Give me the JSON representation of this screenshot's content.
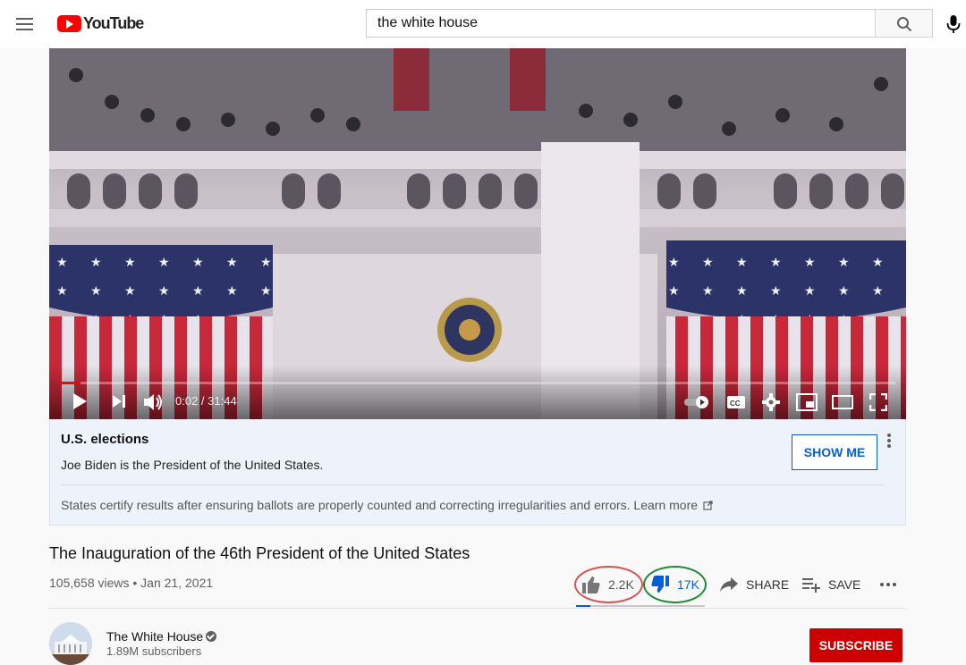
{
  "header": {
    "logo_text": "YouTube",
    "search_value": "the white house",
    "icons": [
      "menu-icon",
      "search-icon",
      "mic-icon"
    ]
  },
  "player": {
    "time": "0:02 / 31:44",
    "progress": 0.0011,
    "controls": [
      "play-icon",
      "next-icon",
      "volume-icon",
      "autoplay-toggle",
      "captions-icon",
      "settings-icon",
      "miniplayer-icon",
      "theater-icon",
      "fullscreen-icon"
    ]
  },
  "info_panel": {
    "title": "U.S. elections",
    "subtitle": "Joe Biden is the President of the United States.",
    "button": "SHOW ME",
    "note": "States certify results after ensuring ballots are properly counted and correcting irregularities and errors.",
    "learn_more": "Learn more"
  },
  "video": {
    "title": "The Inauguration of the 46th President of the United States",
    "meta": "105,658 views • Jan 21, 2021",
    "likes": "2.2K",
    "dislikes": "17K",
    "share": "SHARE",
    "save": "SAVE",
    "like_ratio": 0.11
  },
  "channel": {
    "name": "The White House",
    "subscribers": "1.89M subscribers",
    "subscribe": "SUBSCRIBE"
  },
  "colors": {
    "accent_blue": "#065fd4",
    "subscribe_red": "#cc0000",
    "like_ring": "#d9534f",
    "dislike_ring": "#1f8a35"
  }
}
